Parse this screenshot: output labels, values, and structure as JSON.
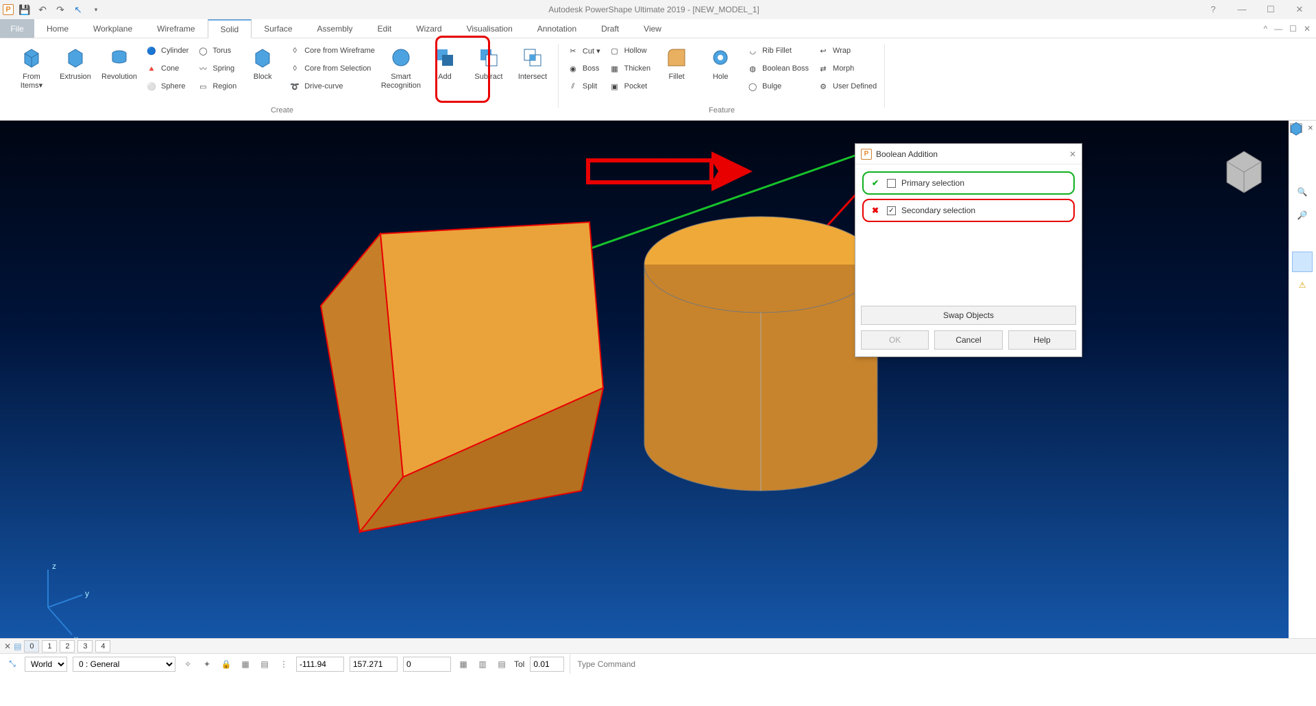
{
  "title": "Autodesk PowerShape Ultimate 2019 - [NEW_MODEL_1]",
  "tabs": {
    "file": "File",
    "home": "Home",
    "workplane": "Workplane",
    "wireframe": "Wireframe",
    "solid": "Solid",
    "surface": "Surface",
    "assembly": "Assembly",
    "edit": "Edit",
    "wizard": "Wizard",
    "visualisation": "Visualisation",
    "annotation": "Annotation",
    "draft": "Draft",
    "view": "View"
  },
  "ribbon": {
    "create": {
      "title": "Create",
      "from_items": "From\nItems▾",
      "extrusion": "Extrusion",
      "revolution": "Revolution",
      "cylinder": "Cylinder",
      "cone": "Cone",
      "sphere": "Sphere",
      "torus": "Torus",
      "spring": "Spring",
      "region": "Region",
      "block": "Block",
      "core_wf": "Core from Wireframe",
      "core_sel": "Core from Selection",
      "drive": "Drive-curve",
      "smart": "Smart\nRecognition",
      "add": "Add",
      "subtract": "Subtract",
      "intersect": "Intersect"
    },
    "feature": {
      "title": "Feature",
      "cut": "Cut ▾",
      "boss": "Boss",
      "split": "Split",
      "hollow": "Hollow",
      "thicken": "Thicken",
      "pocket": "Pocket",
      "fillet": "Fillet",
      "hole": "Hole",
      "rib": "Rib Fillet",
      "boolboss": "Boolean Boss",
      "bulge": "Bulge",
      "wrap": "Wrap",
      "morph": "Morph",
      "userdef": "User Defined"
    }
  },
  "dialog": {
    "title": "Boolean Addition",
    "primary": "Primary selection",
    "secondary": "Secondary selection",
    "swap": "Swap Objects",
    "ok": "OK",
    "cancel": "Cancel",
    "help": "Help"
  },
  "tabstrip": {
    "p0": "0",
    "p1": "1",
    "p2": "2",
    "p3": "3",
    "p4": "4"
  },
  "status": {
    "world": "World",
    "layer": "0  : General",
    "x": "-111.94",
    "y": "157.271",
    "z": "0",
    "tol_lbl": "Tol",
    "tol": "0.01",
    "cmd_ph": "Type Command"
  }
}
